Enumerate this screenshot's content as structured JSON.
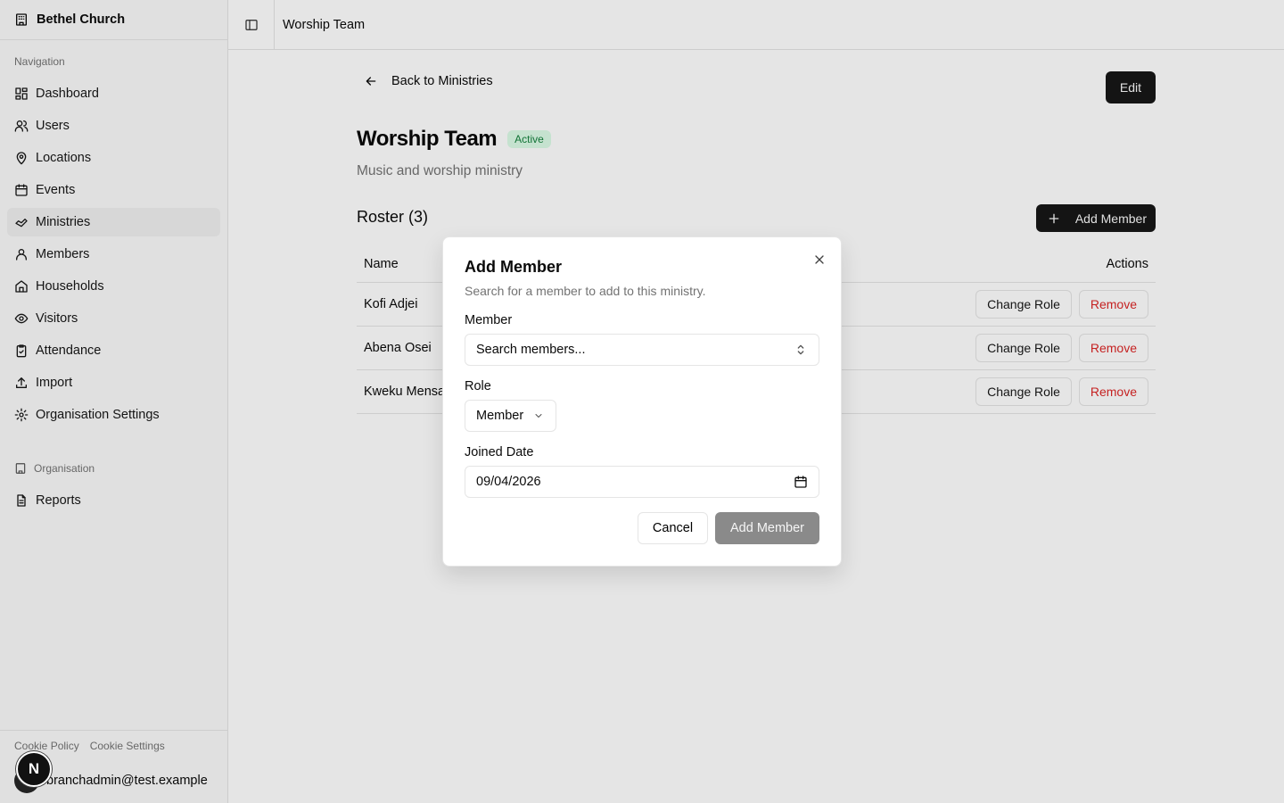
{
  "sidebar": {
    "brand": "Bethel Church",
    "nav_label": "Navigation",
    "items": [
      {
        "label": "Dashboard"
      },
      {
        "label": "Users"
      },
      {
        "label": "Locations"
      },
      {
        "label": "Events"
      },
      {
        "label": "Ministries"
      },
      {
        "label": "Members"
      },
      {
        "label": "Households"
      },
      {
        "label": "Visitors"
      },
      {
        "label": "Attendance"
      },
      {
        "label": "Import"
      },
      {
        "label": "Organisation Settings"
      }
    ],
    "org_label": "Organisation",
    "org_items": [
      {
        "label": "Reports"
      }
    ],
    "footer": {
      "cookie_policy": "Cookie Policy",
      "cookie_settings": "Cookie Settings"
    },
    "user_email": "branchadmin@test.example",
    "next_badge": "N"
  },
  "header": {
    "breadcrumb": "Worship Team"
  },
  "main": {
    "back_label": "Back to Ministries",
    "edit_label": "Edit",
    "title": "Worship Team",
    "status": "Active",
    "subtitle": "Music and worship ministry",
    "roster_title": "Roster (3)",
    "add_member_label": "Add Member",
    "table": {
      "headers": {
        "name": "Name",
        "actions": "Actions"
      },
      "rows": [
        {
          "name": "Kofi Adjei"
        },
        {
          "name": "Abena Osei"
        },
        {
          "name": "Kweku Mensah"
        }
      ],
      "change_role_label": "Change Role",
      "remove_label": "Remove"
    }
  },
  "dialog": {
    "title": "Add Member",
    "description": "Search for a member to add to this ministry.",
    "member_label": "Member",
    "member_placeholder": "Search members...",
    "role_label": "Role",
    "role_value": "Member",
    "date_label": "Joined Date",
    "date_value": "09/04/2026",
    "cancel_label": "Cancel",
    "submit_label": "Add Member"
  },
  "colors": {
    "primary": "#171717",
    "active_badge_bg": "#dcfce7",
    "active_badge_text": "#15803d",
    "danger": "#dc2626"
  }
}
